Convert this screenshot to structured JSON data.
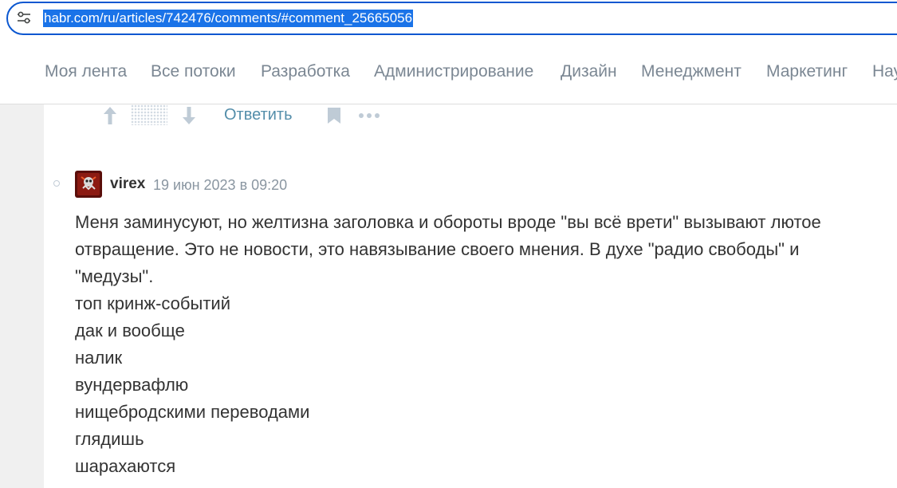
{
  "browser": {
    "url": "habr.com/ru/articles/742476/comments/#comment_25665056",
    "site_info_icon": "tune-icon"
  },
  "nav": {
    "items": [
      {
        "label": "Моя лента"
      },
      {
        "label": "Все потоки"
      },
      {
        "label": "Разработка"
      },
      {
        "label": "Администрирование"
      },
      {
        "label": "Дизайн"
      },
      {
        "label": "Менеджмент"
      },
      {
        "label": "Маркетинг"
      },
      {
        "label": "Нау"
      }
    ]
  },
  "actions": {
    "upvote_icon": "arrow-up-icon",
    "rating_state": "hidden",
    "downvote_icon": "arrow-down-icon",
    "reply_label": "Ответить",
    "bookmark_icon": "bookmark-icon",
    "more_icon": "more-icon"
  },
  "comment": {
    "username": "virex",
    "date": "19 июн 2023 в 09:20",
    "lines": [
      "Меня заминусуют, но желтизна заголовка и обороты вроде \"вы всё врети\" вызывают лютое",
      "отвращение. Это не новости, это навязывание своего мнения. В духе \"радио свободы\" и",
      "\"медузы\".",
      "топ кринж-событий",
      "дак и вообще",
      "налик",
      "вундервафлю",
      "нищебродскими переводами",
      "глядишь",
      "шарахаются"
    ]
  },
  "colors": {
    "accent": "#0b57d0",
    "selection": "#1a73e8",
    "link": "#548eaa",
    "nav_text": "#7b8793",
    "muted_icon": "#bfcbd6",
    "page_bg": "#f0f0f0"
  }
}
